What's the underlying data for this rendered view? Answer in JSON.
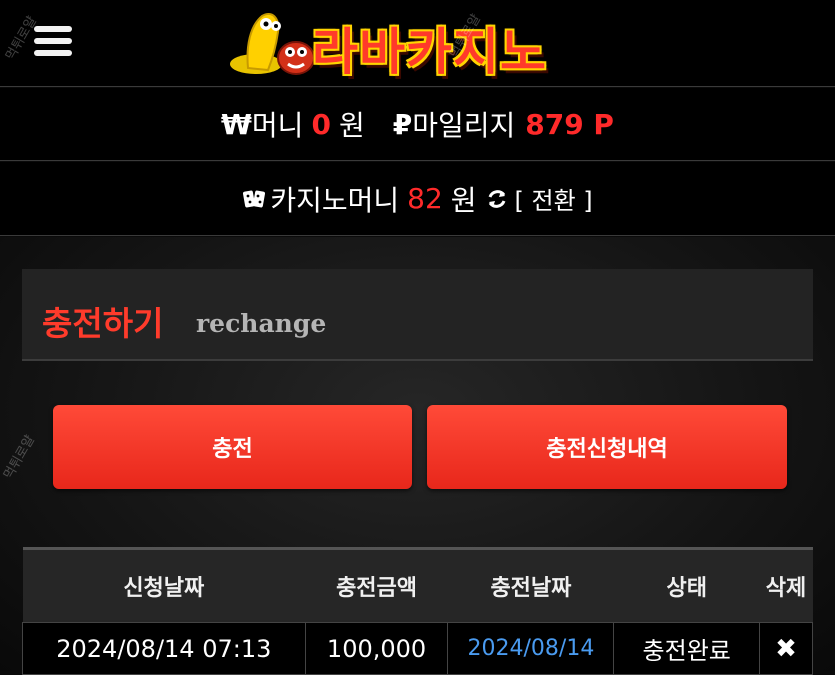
{
  "header": {
    "logo_text": "라바카지노",
    "watermark": "먹튀로얄"
  },
  "wallet": {
    "money_symbol": "₩",
    "money_label": "머니",
    "money_value": "0",
    "money_unit": "원",
    "mileage_symbol": "₽",
    "mileage_label": "마일리지",
    "mileage_value": "879 P"
  },
  "casino": {
    "label": "카지노머니",
    "value": "82",
    "unit": "원",
    "convert_label": "[ 전환 ]"
  },
  "panel": {
    "title": "충전하기",
    "subtitle": "rechange"
  },
  "buttons": {
    "charge": "충전",
    "history": "충전신청내역"
  },
  "table": {
    "headers": [
      "신청날짜",
      "충전금액",
      "충전날짜",
      "상태",
      "삭제"
    ],
    "rows": [
      {
        "request_date": "2024/08/14 07:13",
        "amount": "100,000",
        "charge_date": "2024/08/14",
        "status": "충전완료",
        "delete": "✖"
      }
    ]
  },
  "colors": {
    "accent_red": "#ff2a2a",
    "button_red": "#f0362a",
    "link_blue": "#4a9bf0"
  }
}
